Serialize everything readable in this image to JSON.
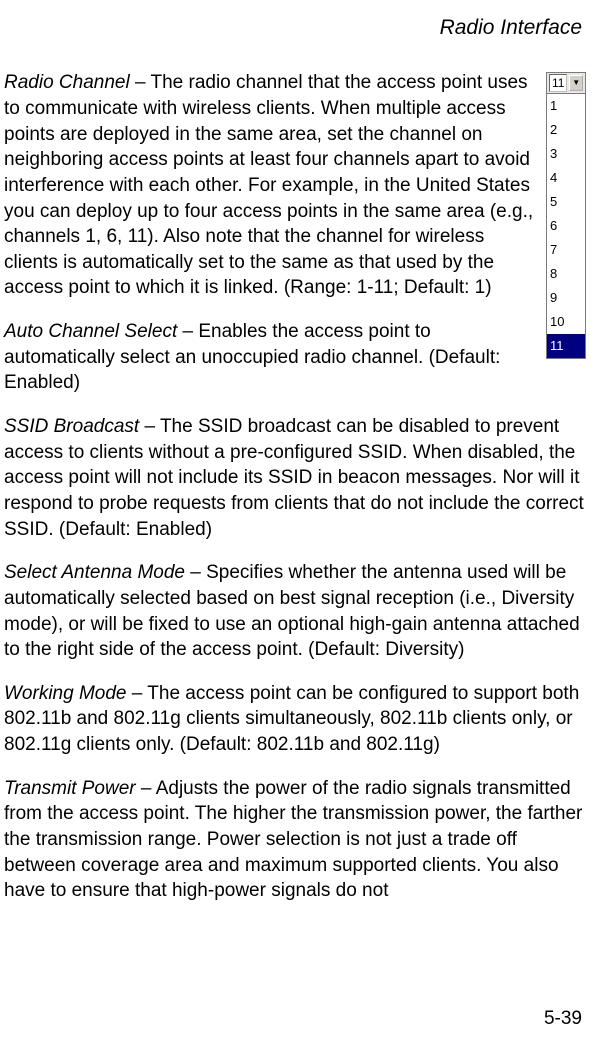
{
  "header": {
    "title": "Radio Interface"
  },
  "dropdown": {
    "selected": "11",
    "options": [
      "1",
      "2",
      "3",
      "4",
      "5",
      "6",
      "7",
      "8",
      "9",
      "10",
      "11"
    ],
    "highlighted": "11"
  },
  "paragraphs": {
    "p1": {
      "term": "Radio Channel",
      "body": " – The radio channel that the access point uses to communicate with wireless clients. When multiple access points are deployed in the same area, set the channel on neighboring access points at least four channels apart to avoid interference with each other. For example, in the United States you can deploy up to four access points in the same area (e.g., channels 1, 6, 11). Also note that the channel for wireless clients is automatically set to the same as that used by the access point to which it is linked. (Range: 1-11; Default: 1)"
    },
    "p2": {
      "term": "Auto Channel Select",
      "body": " – Enables the access point to automatically select an unoccupied radio channel. (Default: Enabled)"
    },
    "p3": {
      "term": "SSID Broadcast",
      "body": " – The SSID broadcast can be disabled to prevent access to clients without a pre-configured SSID. When disabled, the access point will not include its SSID in beacon messages. Nor will it respond to probe requests from clients that do not include the correct SSID. (Default: Enabled)"
    },
    "p4": {
      "term": "Select Antenna Mode",
      "body": " – Specifies whether the antenna used will be automatically selected based on best signal reception (i.e., Diversity mode), or will be fixed to use an optional high-gain antenna attached to the right side of the access point. (Default: Diversity)"
    },
    "p5": {
      "term": "Working Mode",
      "body": " – The access point can be configured to support both 802.11b and 802.11g clients simultaneously, 802.11b clients only, or 802.11g clients only. (Default: 802.11b and 802.11g)"
    },
    "p6": {
      "term": "Transmit Power",
      "body": " – Adjusts the power of the radio signals transmitted from the access point. The higher the transmission power, the farther the transmission range. Power selection is not just a trade off between coverage area and maximum supported clients. You also have to ensure that high-power signals do not"
    }
  },
  "footer": {
    "page": "5-39"
  }
}
